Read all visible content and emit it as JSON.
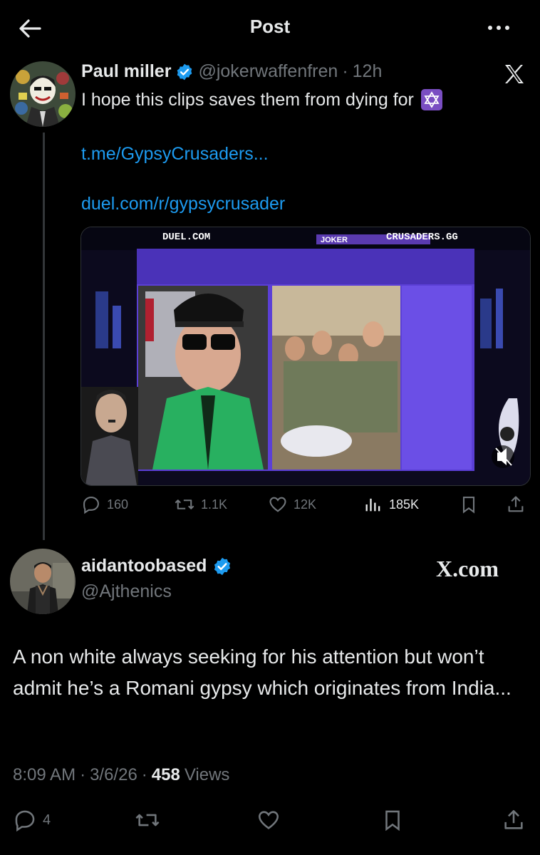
{
  "header": {
    "title": "Post"
  },
  "post": {
    "author_name": "Paul miller",
    "author_handle": "@jokerwaffenfren",
    "separator": "·",
    "time": "12h",
    "text": "I hope this clips saves them from dying for",
    "emoji": "✡",
    "link1": "t.me/GypsyCrusaders...",
    "link2": "duel.com/r/gypsycrusader",
    "platform_icon": "x-logo-icon",
    "media": {
      "label_left": "DUEL.COM",
      "label_mid": "JOKER",
      "label_right": "CRUSADERS.GG"
    },
    "stats": {
      "replies": "160",
      "reposts": "1.1K",
      "likes": "12K",
      "views": "185K"
    }
  },
  "quote": {
    "author_name": "aidantoobased",
    "author_handle": "@Ajthenics",
    "brand": "X.com",
    "text": "A non white always seeking for his attention but won’t admit he’s a Romani gypsy which originates from India...",
    "time": "8:09 AM",
    "sep1": "·",
    "date": "3/6/26",
    "sep2": "·",
    "views_count": "458",
    "views_label": "Views",
    "replies": "4"
  },
  "colors": {
    "accent": "#1d9bf0",
    "muted": "#71767b",
    "text": "#e7e9ea",
    "background": "#000000"
  }
}
